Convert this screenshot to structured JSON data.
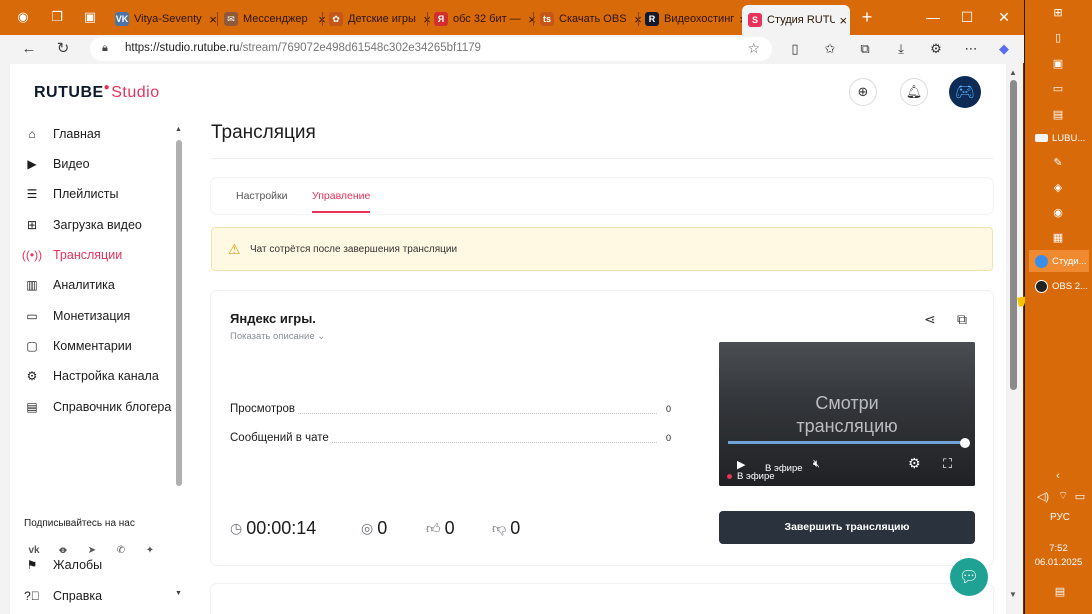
{
  "browser": {
    "tabs": [
      {
        "title": "Vitya-Seventy",
        "fav_color": "#4c75a3",
        "fav_glyph": "VK"
      },
      {
        "title": "Мессенджер",
        "fav_color": "#8e5a3a",
        "fav_glyph": "✉"
      },
      {
        "title": "Детские игры",
        "fav_color": "#c4561a",
        "fav_glyph": "✿"
      },
      {
        "title": "обс 32 бит —",
        "fav_color": "#d12e2e",
        "fav_glyph": "Я"
      },
      {
        "title": "Скачать OBS",
        "fav_color": "#c4561a",
        "fav_glyph": "ts"
      },
      {
        "title": "Видеохостинг",
        "fav_color": "#14192c",
        "fav_glyph": "R"
      },
      {
        "title": "Студия RUTUBE",
        "fav_color": "#e8325a",
        "fav_glyph": "S"
      }
    ],
    "url_host": "https://studio.rutube.ru",
    "url_path": "/stream/769072e498d61548c302e34265bf1179",
    "icons": {
      "back": "back-arrow-icon",
      "refresh": "refresh-icon",
      "lock": "lock-icon",
      "star": "star-icon"
    }
  },
  "app": {
    "logo_main": "RUTUBE",
    "logo_sub": "Studio",
    "sidebar": {
      "items": [
        {
          "label": "Главная",
          "icon": "home-icon"
        },
        {
          "label": "Видео",
          "icon": "video-icon"
        },
        {
          "label": "Плейлисты",
          "icon": "playlist-icon"
        },
        {
          "label": "Загрузка видео",
          "icon": "upload-icon"
        },
        {
          "label": "Трансляции",
          "icon": "broadcast-icon",
          "active": true
        },
        {
          "label": "Аналитика",
          "icon": "analytics-icon"
        },
        {
          "label": "Монетизация",
          "icon": "monetization-icon"
        },
        {
          "label": "Комментарии",
          "icon": "comments-icon"
        },
        {
          "label": "Настройка канала",
          "icon": "settings-icon"
        },
        {
          "label": "Справочник блогера",
          "icon": "book-icon"
        }
      ],
      "subscribe_label": "Подписывайтесь на нас",
      "bottom_items": [
        {
          "label": "Жалобы",
          "icon": "flag-icon"
        },
        {
          "label": "Справка",
          "icon": "help-icon"
        }
      ]
    },
    "page_title": "Трансляция",
    "tabs": [
      {
        "label": "Настройки"
      },
      {
        "label": "Управление",
        "active": true
      }
    ],
    "warning_text": "Чат сотрётся после завершения трансляции",
    "stream": {
      "name": "Яндекс игры.",
      "show_description": "Показать описание",
      "stats": [
        {
          "label": "Просмотров",
          "value": "0"
        },
        {
          "label": "Сообщений в чате",
          "value": "0"
        }
      ],
      "duration": "00:00:14",
      "viewers": "0",
      "likes": "0",
      "dislikes": "0",
      "player_text_line1": "Смотри",
      "player_text_line2": "трансляцию",
      "live_label": "В эфире",
      "live_label_overlay": "В эфире",
      "end_button": "Завершить трансляцию"
    },
    "accent_color": "#e8325a"
  },
  "taskbar": {
    "windows": [
      {
        "label": "LUBU...",
        "color": "#f4f4f4"
      },
      {
        "label": "Студи...",
        "color": "#3a8ee6",
        "active": true
      },
      {
        "label": "OBS 2...",
        "color": "#222222"
      }
    ],
    "lang": "РУС",
    "time": "7:52",
    "date": "06.01.2025"
  }
}
